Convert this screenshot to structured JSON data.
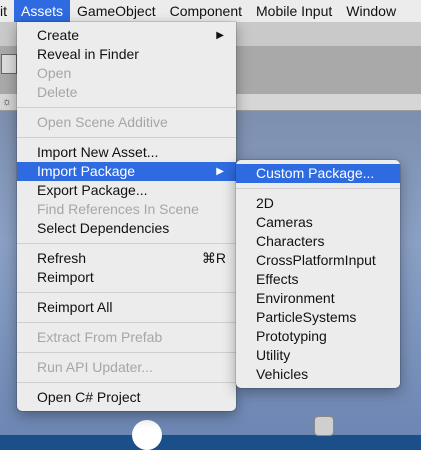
{
  "menubar": {
    "items": [
      "it",
      "Assets",
      "GameObject",
      "Component",
      "Mobile Input",
      "Window"
    ]
  },
  "assets_menu": {
    "create": "Create",
    "reveal_in_finder": "Reveal in Finder",
    "open": "Open",
    "delete": "Delete",
    "open_scene_additive": "Open Scene Additive",
    "import_new_asset": "Import New Asset...",
    "import_package": "Import Package",
    "export_package": "Export Package...",
    "find_references": "Find References In Scene",
    "select_dependencies": "Select Dependencies",
    "refresh": "Refresh",
    "refresh_shortcut": "⌘R",
    "reimport": "Reimport",
    "reimport_all": "Reimport All",
    "extract_from_prefab": "Extract From Prefab",
    "run_api_updater": "Run API Updater...",
    "open_csharp_project": "Open C# Project"
  },
  "import_package_menu": {
    "custom_package": "Custom Package...",
    "items": [
      "2D",
      "Cameras",
      "Characters",
      "CrossPlatformInput",
      "Effects",
      "Environment",
      "ParticleSystems",
      "Prototyping",
      "Utility",
      "Vehicles"
    ]
  },
  "icons": {
    "submenu_arrow": "▶",
    "sun": "☼"
  },
  "colors": {
    "highlight": "#2f6be0",
    "menu_bg": "#ececec",
    "disabled_text": "#a6a6a6"
  }
}
